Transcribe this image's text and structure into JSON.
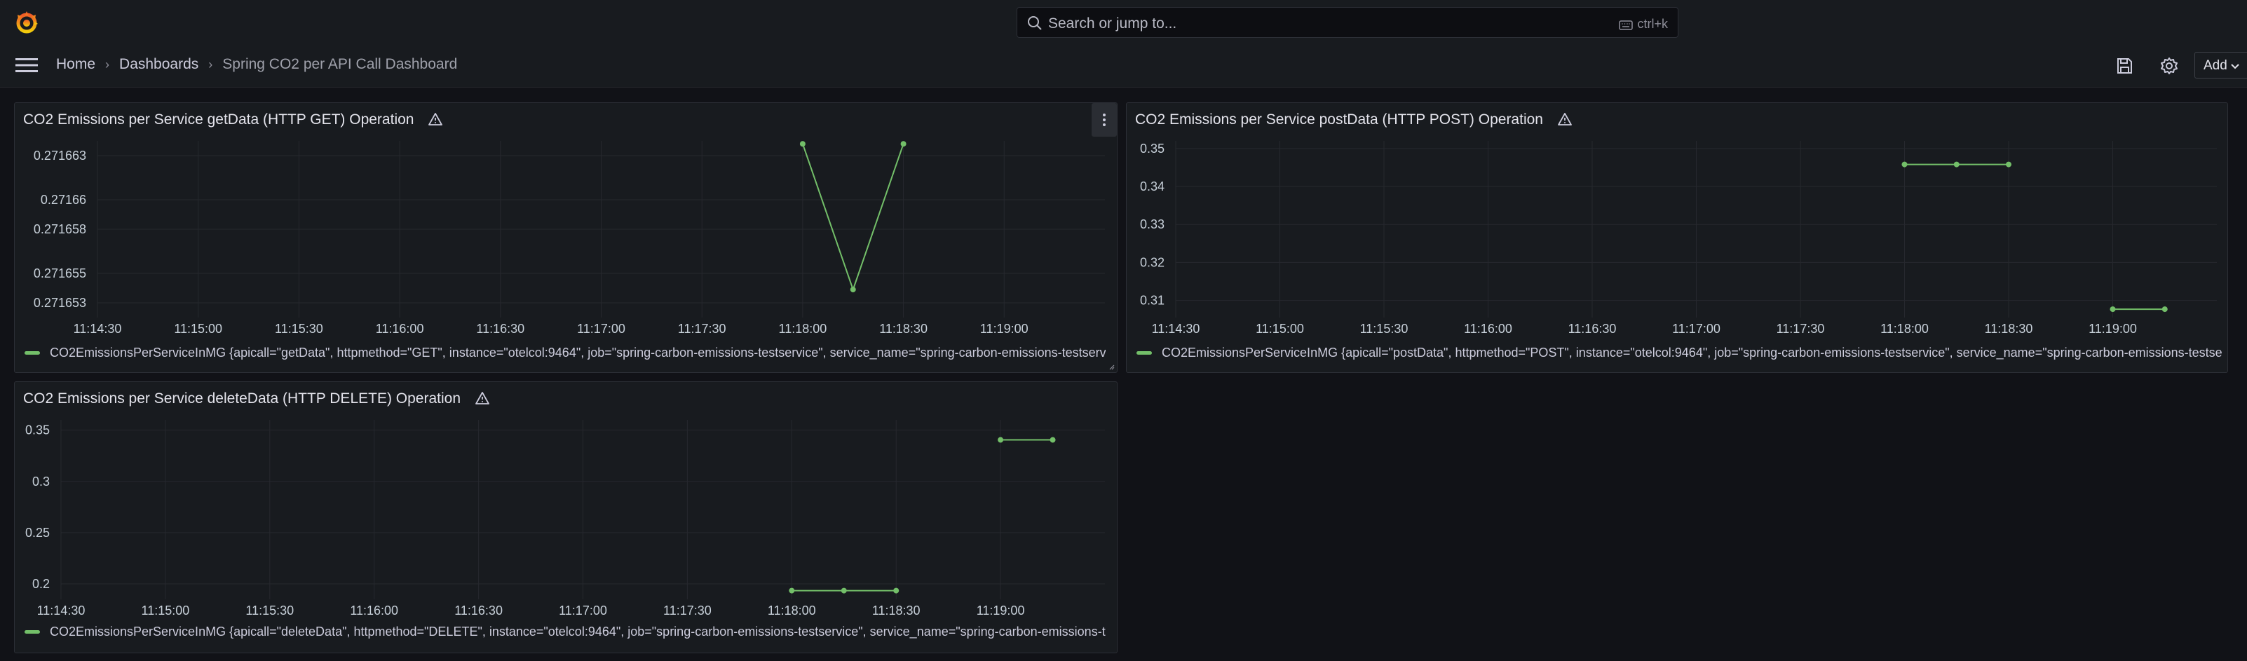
{
  "topbar": {
    "search_placeholder": "Search or jump to...",
    "search_shortcut": "ctrl+k"
  },
  "breadcrumb": {
    "home": "Home",
    "dashboards": "Dashboards",
    "current": "Spring CO2 per API Call Dashboard"
  },
  "toolbar": {
    "add_label": "Add"
  },
  "colors": {
    "series": "#73bf69",
    "background": "#111217",
    "panel": "#181b1f"
  },
  "panels": [
    {
      "title": "CO2 Emissions per Service getData (HTTP GET) Operation",
      "legend": "CO2EmissionsPerServiceInMG {apicall=\"getData\", httpmethod=\"GET\", instance=\"otelcol:9464\", job=\"spring-carbon-emissions-testservice\", service_name=\"spring-carbon-emissions-testservice\"}"
    },
    {
      "title": "CO2 Emissions per Service postData (HTTP POST) Operation",
      "legend": "CO2EmissionsPerServiceInMG {apicall=\"postData\", httpmethod=\"POST\", instance=\"otelcol:9464\", job=\"spring-carbon-emissions-testservice\", service_name=\"spring-carbon-emissions-testservice\"}"
    },
    {
      "title": "CO2 Emissions per Service deleteData (HTTP DELETE) Operation",
      "legend": "CO2EmissionsPerServiceInMG {apicall=\"deleteData\", httpmethod=\"DELETE\", instance=\"otelcol:9464\", job=\"spring-carbon-emissions-testservice\", service_name=\"spring-carbon-emissions-testservice\"}"
    }
  ],
  "chart_data": [
    {
      "type": "line",
      "title": "CO2 Emissions per Service getData (HTTP GET) Operation",
      "x_ticks": [
        "11:14:30",
        "11:15:00",
        "11:15:30",
        "11:16:00",
        "11:16:30",
        "11:17:00",
        "11:17:30",
        "11:18:00",
        "11:18:30",
        "11:19:00"
      ],
      "y_ticks": [
        "0.271653",
        "0.271655",
        "0.271658",
        "0.27166",
        "0.271663"
      ],
      "ylim": [
        0.271652,
        0.271664
      ],
      "grid": true,
      "legend_position": "bottom",
      "series": [
        {
          "name": "CO2EmissionsPerServiceInMG",
          "points": [
            [
              "11:18:00",
              0.2716638
            ],
            [
              "11:18:15",
              0.2716539
            ],
            [
              "11:18:30",
              0.2716638
            ]
          ]
        }
      ]
    },
    {
      "type": "line",
      "title": "CO2 Emissions per Service postData (HTTP POST) Operation",
      "x_ticks": [
        "11:14:30",
        "11:15:00",
        "11:15:30",
        "11:16:00",
        "11:16:30",
        "11:17:00",
        "11:17:30",
        "11:18:00",
        "11:18:30",
        "11:19:00"
      ],
      "y_ticks": [
        "0.31",
        "0.32",
        "0.33",
        "0.34",
        "0.35"
      ],
      "ylim": [
        0.3055,
        0.352
      ],
      "grid": true,
      "legend_position": "bottom",
      "series": [
        {
          "name": "CO2EmissionsPerServiceInMG",
          "segments": [
            [
              [
                "11:18:00",
                0.3458
              ],
              [
                "11:18:15",
                0.3458
              ],
              [
                "11:18:30",
                0.3458
              ]
            ],
            [
              [
                "11:19:00",
                0.3077
              ],
              [
                "11:19:15",
                0.3077
              ]
            ]
          ]
        }
      ]
    },
    {
      "type": "line",
      "title": "CO2 Emissions per Service deleteData (HTTP DELETE) Operation",
      "x_ticks": [
        "11:14:30",
        "11:15:00",
        "11:15:30",
        "11:16:00",
        "11:16:30",
        "11:17:00",
        "11:17:30",
        "11:18:00",
        "11:18:30",
        "11:19:00"
      ],
      "y_ticks": [
        "0.2",
        "0.25",
        "0.3",
        "0.35"
      ],
      "ylim": [
        0.185,
        0.36
      ],
      "grid": true,
      "legend_position": "bottom",
      "series": [
        {
          "name": "CO2EmissionsPerServiceInMG",
          "segments": [
            [
              [
                "11:18:00",
                0.1935
              ],
              [
                "11:18:15",
                0.1935
              ],
              [
                "11:18:30",
                0.1935
              ]
            ],
            [
              [
                "11:19:00",
                0.3405
              ],
              [
                "11:19:15",
                0.3405
              ]
            ]
          ]
        }
      ]
    }
  ]
}
